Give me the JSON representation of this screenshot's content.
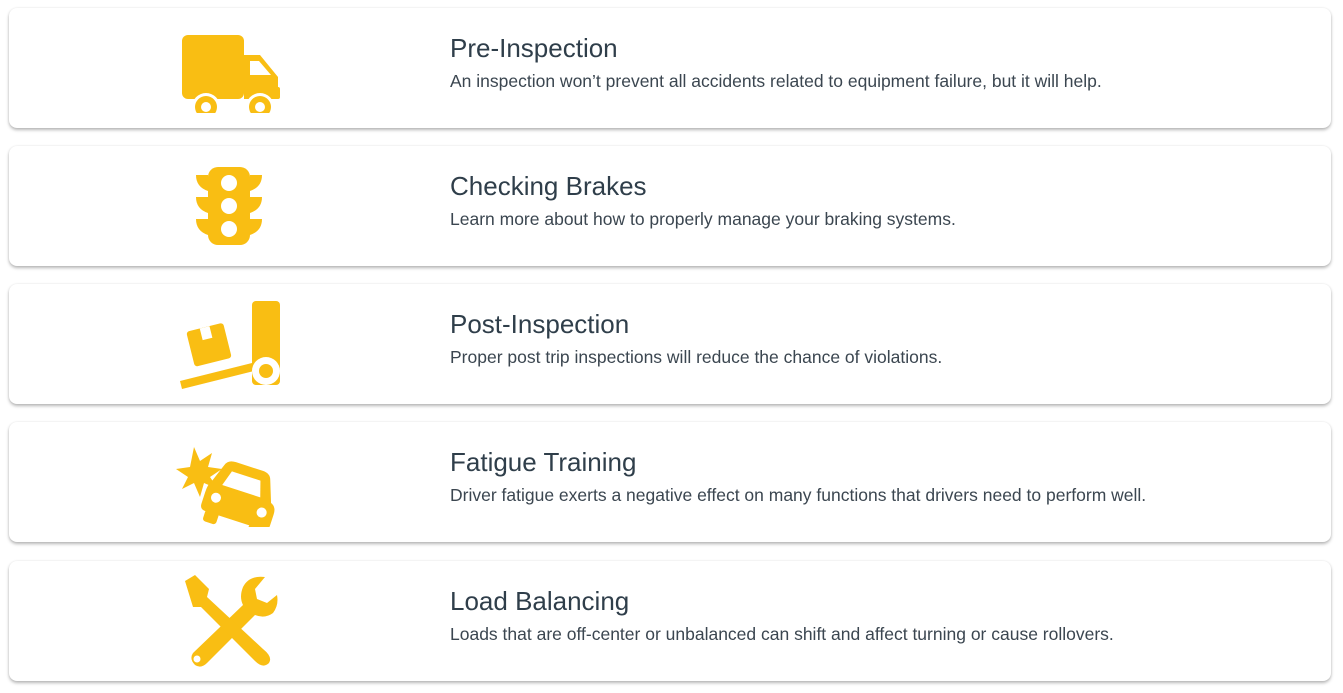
{
  "accent_color": "#F9BE13",
  "items": [
    {
      "icon": "truck-icon",
      "title": "Pre-Inspection",
      "description": "An inspection won’t prevent all accidents related to equipment failure, but it will help."
    },
    {
      "icon": "traffic-light-icon",
      "title": "Checking Brakes",
      "description": "Learn more about how to properly manage your braking systems."
    },
    {
      "icon": "truck-loading-icon",
      "title": "Post-Inspection",
      "description": "Proper post trip inspections will reduce the chance of violations."
    },
    {
      "icon": "car-crash-icon",
      "title": "Fatigue Training",
      "description": "Driver fatigue exerts a negative effect on many functions that drivers need to perform well."
    },
    {
      "icon": "tools-icon",
      "title": "Load Balancing",
      "description": "Loads that are off-center or unbalanced can shift and affect turning or cause rollovers."
    }
  ]
}
